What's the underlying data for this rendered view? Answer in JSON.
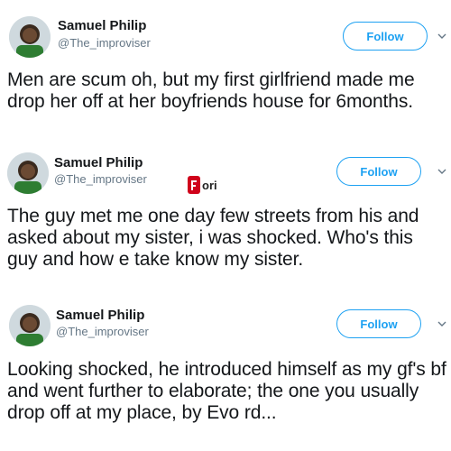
{
  "tweets": [
    {
      "author_name": "Samuel Philip",
      "author_handle": "@The_improviser",
      "follow_label": "Follow",
      "text": "Men are scum oh, but my first girlfriend made me drop her off at her boyfriends house for 6months."
    },
    {
      "author_name": "Samuel Philip",
      "author_handle": "@The_improviser",
      "follow_label": "Follow",
      "text": "The guy met me one day few streets from his and asked about my sister, i was shocked. Who's this guy and how e take know my sister."
    },
    {
      "author_name": "Samuel Philip",
      "author_handle": "@The_improviser",
      "follow_label": "Follow",
      "text": "Looking shocked, he introduced himself as my gf's bf and went further to elaborate; the one you usually drop off at my place, by Evo rd..."
    }
  ],
  "watermark_text": "ori",
  "colors": {
    "accent": "#1da1f2",
    "handle": "#657786",
    "text": "#14171a",
    "watermark": "#d0021b"
  },
  "icons": {
    "chevron": "chevron-down-icon",
    "avatar": "avatar-icon",
    "watermark": "logo-icon"
  }
}
